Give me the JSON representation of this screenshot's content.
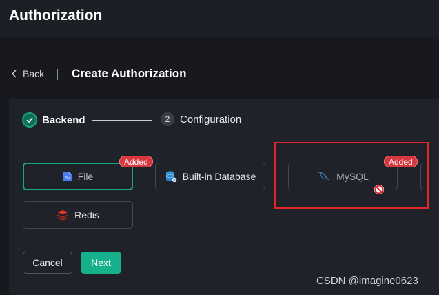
{
  "header": {
    "title": "Authorization"
  },
  "nav": {
    "back_label": "Back",
    "page_title": "Create Authorization"
  },
  "steps": [
    {
      "label": "Backend",
      "state": "done"
    },
    {
      "number": "2",
      "label": "Configuration",
      "state": "pending"
    }
  ],
  "backends": [
    {
      "label": "File",
      "icon": "file-icon",
      "badge": "Added",
      "selected": true
    },
    {
      "label": "Built-in Database",
      "icon": "database-icon"
    },
    {
      "label": "MySQL",
      "icon": "mysql-dolphin-icon",
      "badge": "Added",
      "disabled": true
    },
    {
      "label": "Redis",
      "icon": "redis-icon"
    }
  ],
  "actions": {
    "cancel_label": "Cancel",
    "next_label": "Next"
  },
  "watermark": "CSDN @imagine0623",
  "colors": {
    "accent": "#16b08a",
    "badge": "#d9373e",
    "highlight": "#e0262b",
    "background": "#17191e"
  }
}
